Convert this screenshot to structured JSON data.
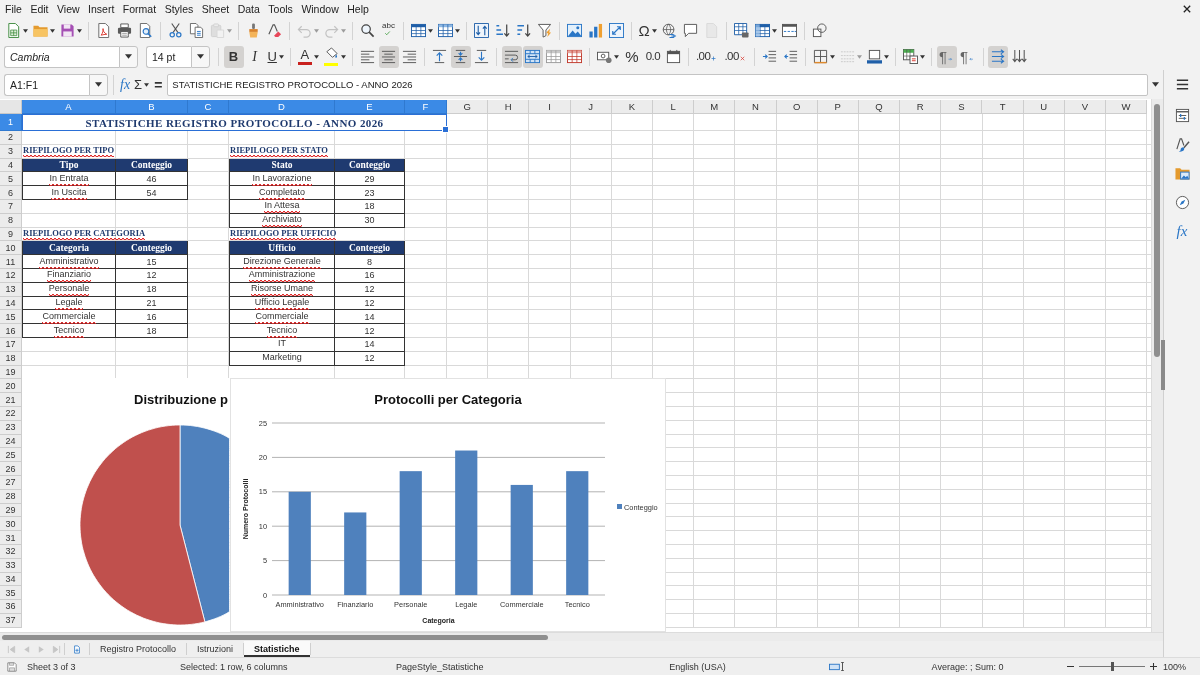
{
  "menu_bar": {
    "items": [
      "File",
      "Edit",
      "View",
      "Insert",
      "Format",
      "Styles",
      "Sheet",
      "Data",
      "Tools",
      "Window",
      "Help"
    ]
  },
  "standard_toolbar": {
    "groups": [
      [
        {
          "kind": "new-spreadsheet",
          "disabled": false,
          "dropdown": true
        },
        {
          "kind": "open",
          "disabled": false,
          "dropdown": true
        },
        {
          "kind": "save",
          "disabled": false,
          "dropdown": true
        }
      ],
      [
        {
          "kind": "export-pdf",
          "disabled": false,
          "dropdown": false
        },
        {
          "kind": "print",
          "disabled": false,
          "dropdown": false
        },
        {
          "kind": "print-preview",
          "disabled": false,
          "dropdown": false
        }
      ],
      [
        {
          "kind": "cut",
          "disabled": false,
          "dropdown": false
        },
        {
          "kind": "copy",
          "disabled": false,
          "dropdown": false
        },
        {
          "kind": "paste",
          "disabled": true,
          "dropdown": true
        }
      ],
      [
        {
          "kind": "clone-formatting",
          "disabled": false,
          "dropdown": false
        },
        {
          "kind": "clear-formatting",
          "disabled": false,
          "dropdown": false
        }
      ],
      [
        {
          "kind": "undo",
          "disabled": true,
          "dropdown": true
        },
        {
          "kind": "redo",
          "disabled": true,
          "dropdown": true
        }
      ],
      [
        {
          "kind": "find-replace",
          "disabled": false,
          "dropdown": false
        },
        {
          "kind": "spelling",
          "label": "abc",
          "disabled": false,
          "dropdown": false
        }
      ],
      [
        {
          "kind": "rows",
          "disabled": false,
          "dropdown": true
        },
        {
          "kind": "columns",
          "disabled": false,
          "dropdown": true
        }
      ],
      [
        {
          "kind": "sort",
          "disabled": false,
          "dropdown": false
        },
        {
          "kind": "sort-ascending",
          "disabled": false,
          "dropdown": false
        },
        {
          "kind": "sort-descending",
          "disabled": false,
          "dropdown": false
        },
        {
          "kind": "autofilter",
          "disabled": false,
          "dropdown": false
        }
      ],
      [
        {
          "kind": "image",
          "disabled": false,
          "dropdown": false
        },
        {
          "kind": "chart",
          "disabled": false,
          "dropdown": false
        },
        {
          "kind": "pivot-table",
          "disabled": false,
          "dropdown": false
        }
      ],
      [
        {
          "kind": "special-character",
          "label": "Ω",
          "disabled": false,
          "dropdown": true
        },
        {
          "kind": "hyperlink",
          "disabled": false,
          "dropdown": false
        },
        {
          "kind": "comment",
          "disabled": false,
          "dropdown": false
        },
        {
          "kind": "headers-footers",
          "disabled": true,
          "dropdown": false
        }
      ],
      [
        {
          "kind": "print-area",
          "disabled": false,
          "dropdown": false
        },
        {
          "kind": "freeze",
          "disabled": false,
          "dropdown": true
        },
        {
          "kind": "split-window",
          "disabled": false,
          "dropdown": false
        }
      ],
      [
        {
          "kind": "shapes",
          "disabled": false,
          "dropdown": false
        }
      ]
    ]
  },
  "formatting_toolbar": {
    "font_name": {
      "value": "Cambria"
    },
    "font_size": {
      "value": "14 pt"
    },
    "groups": [
      [
        {
          "kind": "bold",
          "label": "B",
          "pressed": true,
          "disabled": false,
          "dropdown": false
        },
        {
          "kind": "italic",
          "label": "I",
          "pressed": false,
          "disabled": false,
          "dropdown": false
        },
        {
          "kind": "underline",
          "label": "U",
          "pressed": false,
          "disabled": false,
          "dropdown": true
        }
      ],
      [
        {
          "kind": "font-color",
          "label": "A",
          "color": "#c9211e",
          "pressed": false,
          "disabled": false,
          "dropdown": true
        },
        {
          "kind": "highlight",
          "color": "#ffff00",
          "pressed": false,
          "disabled": false,
          "dropdown": true
        }
      ],
      [
        {
          "kind": "align-left",
          "pressed": false,
          "disabled": false,
          "dropdown": false
        },
        {
          "kind": "align-center",
          "pressed": true,
          "disabled": false,
          "dropdown": false
        },
        {
          "kind": "align-right",
          "pressed": false,
          "disabled": false,
          "dropdown": false
        }
      ],
      [
        {
          "kind": "align-top",
          "pressed": false,
          "disabled": false,
          "dropdown": false
        },
        {
          "kind": "align-middle",
          "pressed": true,
          "disabled": false,
          "dropdown": false
        },
        {
          "kind": "align-bottom",
          "pressed": false,
          "disabled": false,
          "dropdown": false
        }
      ],
      [
        {
          "kind": "wrap-text",
          "pressed": true,
          "disabled": false,
          "dropdown": false
        },
        {
          "kind": "merge-center",
          "pressed": true,
          "disabled": false,
          "dropdown": false
        },
        {
          "kind": "merge",
          "pressed": false,
          "disabled": false,
          "dropdown": false
        },
        {
          "kind": "unmerge",
          "pressed": false,
          "disabled": false,
          "dropdown": false
        }
      ],
      [
        {
          "kind": "currency",
          "pressed": false,
          "disabled": false,
          "dropdown": true
        },
        {
          "kind": "percent",
          "label": "%",
          "pressed": false,
          "disabled": false,
          "dropdown": false
        },
        {
          "kind": "number",
          "label": "0.0",
          "pressed": false,
          "disabled": false,
          "dropdown": false
        },
        {
          "kind": "date",
          "pressed": false,
          "disabled": false,
          "dropdown": false
        }
      ],
      [
        {
          "kind": "add-decimal",
          "label": ".00",
          "pressed": false,
          "disabled": false,
          "dropdown": false
        },
        {
          "kind": "delete-decimal",
          "label": ".00",
          "pressed": false,
          "disabled": false,
          "dropdown": false
        }
      ],
      [
        {
          "kind": "increase-indent",
          "pressed": false,
          "disabled": false,
          "dropdown": false
        },
        {
          "kind": "decrease-indent",
          "pressed": false,
          "disabled": false,
          "dropdown": false
        }
      ],
      [
        {
          "kind": "borders",
          "pressed": false,
          "disabled": false,
          "dropdown": true
        },
        {
          "kind": "border-style",
          "pressed": false,
          "disabled": true,
          "dropdown": true
        },
        {
          "kind": "border-color",
          "pressed": false,
          "disabled": false,
          "dropdown": true
        }
      ],
      [
        {
          "kind": "conditional",
          "pressed": false,
          "disabled": false,
          "dropdown": true
        }
      ],
      [
        {
          "kind": "ltr",
          "label": "¶",
          "pressed": true,
          "disabled": false,
          "dropdown": false
        },
        {
          "kind": "rtl",
          "label": "¶",
          "pressed": false,
          "disabled": false,
          "dropdown": false
        }
      ],
      [
        {
          "kind": "text-direction",
          "pressed": true,
          "disabled": false,
          "dropdown": false
        },
        {
          "kind": "vertical-text",
          "pressed": false,
          "disabled": false,
          "dropdown": false
        }
      ]
    ]
  },
  "formula_bar": {
    "name_box": {
      "value": "A1:F1"
    },
    "function_wizard": {
      "label": "fx"
    },
    "sum": {
      "label": "Σ"
    },
    "equals": {
      "label": "="
    },
    "input": {
      "value": "STATISTICHE REGISTRO PROTOCOLLO - ANNO 2026"
    }
  },
  "sidebar": {
    "tabs": [
      {
        "kind": "properties",
        "selected": false
      },
      {
        "kind": "styles",
        "selected": false
      },
      {
        "kind": "gallery",
        "selected": false
      },
      {
        "kind": "navigator",
        "selected": false
      },
      {
        "kind": "functions",
        "label": "fx",
        "selected": false
      }
    ]
  },
  "sheet": {
    "columns": [
      {
        "label": "A",
        "selected": true
      },
      {
        "label": "B",
        "selected": true
      },
      {
        "label": "C",
        "selected": true
      },
      {
        "label": "D",
        "selected": true
      },
      {
        "label": "E",
        "selected": true
      },
      {
        "label": "F",
        "selected": true
      },
      {
        "label": "G",
        "selected": false
      },
      {
        "label": "H",
        "selected": false
      },
      {
        "label": "I",
        "selected": false
      },
      {
        "label": "J",
        "selected": false
      },
      {
        "label": "K",
        "selected": false
      },
      {
        "label": "L",
        "selected": false
      },
      {
        "label": "M",
        "selected": false
      },
      {
        "label": "N",
        "selected": false
      },
      {
        "label": "O",
        "selected": false
      },
      {
        "label": "P",
        "selected": false
      },
      {
        "label": "Q",
        "selected": false
      },
      {
        "label": "R",
        "selected": false
      },
      {
        "label": "S",
        "selected": false
      },
      {
        "label": "T",
        "selected": false
      },
      {
        "label": "U",
        "selected": false
      },
      {
        "label": "V",
        "selected": false
      },
      {
        "label": "W",
        "selected": false
      }
    ],
    "rows": [
      {
        "label": "1",
        "selected": true
      },
      {
        "label": "2",
        "selected": false
      },
      {
        "label": "3",
        "selected": false
      },
      {
        "label": "4",
        "selected": false
      },
      {
        "label": "5",
        "selected": false
      },
      {
        "label": "6",
        "selected": false
      },
      {
        "label": "7",
        "selected": false
      },
      {
        "label": "8",
        "selected": false
      },
      {
        "label": "9",
        "selected": false
      },
      {
        "label": "10",
        "selected": false
      },
      {
        "label": "11",
        "selected": false
      },
      {
        "label": "12",
        "selected": false
      },
      {
        "label": "13",
        "selected": false
      },
      {
        "label": "14",
        "selected": false
      },
      {
        "label": "15",
        "selected": false
      },
      {
        "label": "16",
        "selected": false
      },
      {
        "label": "17",
        "selected": false
      },
      {
        "label": "18",
        "selected": false
      },
      {
        "label": "19",
        "selected": false
      },
      {
        "label": "20",
        "selected": false
      },
      {
        "label": "21",
        "selected": false
      },
      {
        "label": "22",
        "selected": false
      },
      {
        "label": "23",
        "selected": false
      },
      {
        "label": "24",
        "selected": false
      },
      {
        "label": "25",
        "selected": false
      },
      {
        "label": "26",
        "selected": false
      },
      {
        "label": "27",
        "selected": false
      },
      {
        "label": "28",
        "selected": false
      },
      {
        "label": "29",
        "selected": false
      },
      {
        "label": "30",
        "selected": false
      },
      {
        "label": "31",
        "selected": false
      },
      {
        "label": "32",
        "selected": false
      },
      {
        "label": "33",
        "selected": false
      },
      {
        "label": "34",
        "selected": false
      },
      {
        "label": "35",
        "selected": false
      },
      {
        "label": "36",
        "selected": false
      },
      {
        "label": "37",
        "selected": false
      }
    ],
    "title": {
      "text": "STATISTICHE REGISTRO PROTOCOLLO - ANNO 2026",
      "selected": true
    },
    "tables": [
      {
        "heading": {
          "text": "RIEPILOGO PER TIPO",
          "misspelled": true
        },
        "columns": [
          "Tipo",
          "Conteggio"
        ],
        "rows": [
          {
            "label": "In Entrata",
            "count": "46",
            "misspelled": true
          },
          {
            "label": "In Uscita",
            "count": "54",
            "misspelled": true
          }
        ]
      },
      {
        "heading": {
          "text": "RIEPILOGO PER STATO",
          "misspelled": true
        },
        "columns": [
          "Stato",
          "Conteggio"
        ],
        "rows": [
          {
            "label": "In Lavorazione",
            "count": "29",
            "misspelled": true
          },
          {
            "label": "Completato",
            "count": "23",
            "misspelled": true
          },
          {
            "label": "In Attesa",
            "count": "18",
            "misspelled": true
          },
          {
            "label": "Archiviato",
            "count": "30",
            "misspelled": true
          }
        ]
      },
      {
        "heading": {
          "text": "RIEPILOGO PER CATEGORIA",
          "misspelled": true
        },
        "columns": [
          "Categoria",
          "Conteggio"
        ],
        "rows": [
          {
            "label": "Amministrativo",
            "count": "15",
            "misspelled": true
          },
          {
            "label": "Finanziario",
            "count": "12",
            "misspelled": true
          },
          {
            "label": "Personale",
            "count": "18",
            "misspelled": true
          },
          {
            "label": "Legale",
            "count": "21",
            "misspelled": true
          },
          {
            "label": "Commerciale",
            "count": "16",
            "misspelled": true
          },
          {
            "label": "Tecnico",
            "count": "18",
            "misspelled": true
          }
        ]
      },
      {
        "heading": {
          "text": "RIEPILOGO PER UFFICIO",
          "misspelled": true
        },
        "columns": [
          "Ufficio",
          "Conteggio"
        ],
        "rows": [
          {
            "label": "Direzione Generale",
            "count": "8",
            "misspelled": true
          },
          {
            "label": "Amministrazione",
            "count": "16",
            "misspelled": true
          },
          {
            "label": "Risorse Umane",
            "count": "12",
            "misspelled": true
          },
          {
            "label": "Ufficio Legale",
            "count": "12",
            "misspelled": true
          },
          {
            "label": "Commerciale",
            "count": "14",
            "misspelled": true
          },
          {
            "label": "Tecnico",
            "count": "12",
            "misspelled": true
          },
          {
            "label": "IT",
            "count": "14",
            "misspelled": false
          },
          {
            "label": "Marketing",
            "count": "12",
            "misspelled": false
          }
        ]
      }
    ]
  },
  "pie_chart": {
    "title": "Distribuzione p"
  },
  "bar_chart": {
    "chart_data": {
      "type": "bar",
      "title": "Protocolli per Categoria",
      "xlabel": "Categoria",
      "ylabel": "Numero Protocolli",
      "categories": [
        "Amministrativo",
        "Finanziario",
        "Personale",
        "Legale",
        "Commerciale",
        "Tecnico"
      ],
      "series": [
        {
          "name": "Conteggio",
          "color": "#4f81bd",
          "values": [
            15,
            12,
            18,
            21,
            16,
            18
          ]
        }
      ],
      "ylim": [
        0,
        25
      ],
      "yticks": [
        0,
        5,
        10,
        15,
        20,
        25
      ],
      "grid": true
    }
  },
  "sheet_tabs": [
    {
      "label": "Registro Protocollo",
      "selected": false
    },
    {
      "label": "Istruzioni",
      "selected": false
    },
    {
      "label": "Statistiche",
      "selected": true
    }
  ],
  "status_bar": {
    "sheet_position": "Sheet 3 of 3",
    "selection": "Selected: 1 row, 6 columns",
    "page_style": "PageStyle_Statistiche",
    "language": "English (USA)",
    "summary": "Average: ; Sum: 0",
    "zoom": {
      "level": 0.5,
      "label": "100%"
    }
  }
}
